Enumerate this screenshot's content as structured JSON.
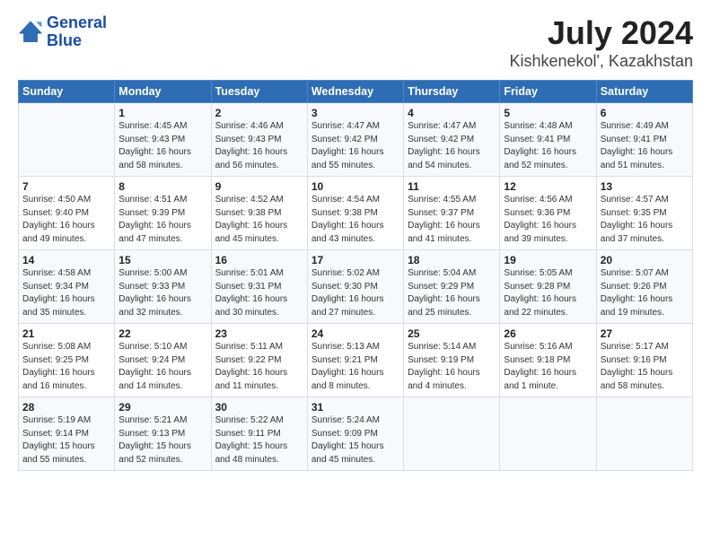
{
  "header": {
    "logo_line1": "General",
    "logo_line2": "Blue",
    "title": "July 2024",
    "subtitle": "Kishkenekol', Kazakhstan"
  },
  "columns": [
    "Sunday",
    "Monday",
    "Tuesday",
    "Wednesday",
    "Thursday",
    "Friday",
    "Saturday"
  ],
  "rows": [
    [
      {
        "day": "",
        "text": ""
      },
      {
        "day": "1",
        "text": "Sunrise: 4:45 AM\nSunset: 9:43 PM\nDaylight: 16 hours\nand 58 minutes."
      },
      {
        "day": "2",
        "text": "Sunrise: 4:46 AM\nSunset: 9:43 PM\nDaylight: 16 hours\nand 56 minutes."
      },
      {
        "day": "3",
        "text": "Sunrise: 4:47 AM\nSunset: 9:42 PM\nDaylight: 16 hours\nand 55 minutes."
      },
      {
        "day": "4",
        "text": "Sunrise: 4:47 AM\nSunset: 9:42 PM\nDaylight: 16 hours\nand 54 minutes."
      },
      {
        "day": "5",
        "text": "Sunrise: 4:48 AM\nSunset: 9:41 PM\nDaylight: 16 hours\nand 52 minutes."
      },
      {
        "day": "6",
        "text": "Sunrise: 4:49 AM\nSunset: 9:41 PM\nDaylight: 16 hours\nand 51 minutes."
      }
    ],
    [
      {
        "day": "7",
        "text": "Sunrise: 4:50 AM\nSunset: 9:40 PM\nDaylight: 16 hours\nand 49 minutes."
      },
      {
        "day": "8",
        "text": "Sunrise: 4:51 AM\nSunset: 9:39 PM\nDaylight: 16 hours\nand 47 minutes."
      },
      {
        "day": "9",
        "text": "Sunrise: 4:52 AM\nSunset: 9:38 PM\nDaylight: 16 hours\nand 45 minutes."
      },
      {
        "day": "10",
        "text": "Sunrise: 4:54 AM\nSunset: 9:38 PM\nDaylight: 16 hours\nand 43 minutes."
      },
      {
        "day": "11",
        "text": "Sunrise: 4:55 AM\nSunset: 9:37 PM\nDaylight: 16 hours\nand 41 minutes."
      },
      {
        "day": "12",
        "text": "Sunrise: 4:56 AM\nSunset: 9:36 PM\nDaylight: 16 hours\nand 39 minutes."
      },
      {
        "day": "13",
        "text": "Sunrise: 4:57 AM\nSunset: 9:35 PM\nDaylight: 16 hours\nand 37 minutes."
      }
    ],
    [
      {
        "day": "14",
        "text": "Sunrise: 4:58 AM\nSunset: 9:34 PM\nDaylight: 16 hours\nand 35 minutes."
      },
      {
        "day": "15",
        "text": "Sunrise: 5:00 AM\nSunset: 9:33 PM\nDaylight: 16 hours\nand 32 minutes."
      },
      {
        "day": "16",
        "text": "Sunrise: 5:01 AM\nSunset: 9:31 PM\nDaylight: 16 hours\nand 30 minutes."
      },
      {
        "day": "17",
        "text": "Sunrise: 5:02 AM\nSunset: 9:30 PM\nDaylight: 16 hours\nand 27 minutes."
      },
      {
        "day": "18",
        "text": "Sunrise: 5:04 AM\nSunset: 9:29 PM\nDaylight: 16 hours\nand 25 minutes."
      },
      {
        "day": "19",
        "text": "Sunrise: 5:05 AM\nSunset: 9:28 PM\nDaylight: 16 hours\nand 22 minutes."
      },
      {
        "day": "20",
        "text": "Sunrise: 5:07 AM\nSunset: 9:26 PM\nDaylight: 16 hours\nand 19 minutes."
      }
    ],
    [
      {
        "day": "21",
        "text": "Sunrise: 5:08 AM\nSunset: 9:25 PM\nDaylight: 16 hours\nand 16 minutes."
      },
      {
        "day": "22",
        "text": "Sunrise: 5:10 AM\nSunset: 9:24 PM\nDaylight: 16 hours\nand 14 minutes."
      },
      {
        "day": "23",
        "text": "Sunrise: 5:11 AM\nSunset: 9:22 PM\nDaylight: 16 hours\nand 11 minutes."
      },
      {
        "day": "24",
        "text": "Sunrise: 5:13 AM\nSunset: 9:21 PM\nDaylight: 16 hours\nand 8 minutes."
      },
      {
        "day": "25",
        "text": "Sunrise: 5:14 AM\nSunset: 9:19 PM\nDaylight: 16 hours\nand 4 minutes."
      },
      {
        "day": "26",
        "text": "Sunrise: 5:16 AM\nSunset: 9:18 PM\nDaylight: 16 hours\nand 1 minute."
      },
      {
        "day": "27",
        "text": "Sunrise: 5:17 AM\nSunset: 9:16 PM\nDaylight: 15 hours\nand 58 minutes."
      }
    ],
    [
      {
        "day": "28",
        "text": "Sunrise: 5:19 AM\nSunset: 9:14 PM\nDaylight: 15 hours\nand 55 minutes."
      },
      {
        "day": "29",
        "text": "Sunrise: 5:21 AM\nSunset: 9:13 PM\nDaylight: 15 hours\nand 52 minutes."
      },
      {
        "day": "30",
        "text": "Sunrise: 5:22 AM\nSunset: 9:11 PM\nDaylight: 15 hours\nand 48 minutes."
      },
      {
        "day": "31",
        "text": "Sunrise: 5:24 AM\nSunset: 9:09 PM\nDaylight: 15 hours\nand 45 minutes."
      },
      {
        "day": "",
        "text": ""
      },
      {
        "day": "",
        "text": ""
      },
      {
        "day": "",
        "text": ""
      }
    ]
  ]
}
